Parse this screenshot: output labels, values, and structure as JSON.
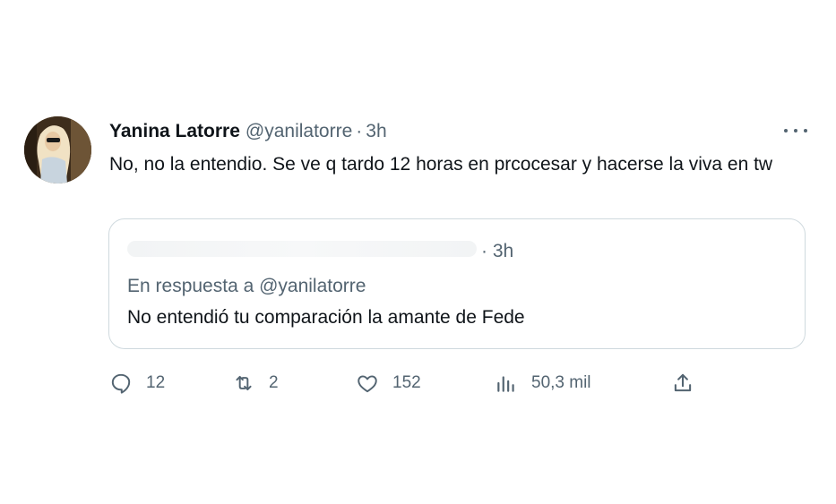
{
  "tweet": {
    "author_name": "Yanina Latorre",
    "handle": "@yanilatorre",
    "separator": "·",
    "time": "3h",
    "text": "No, no la entendio. Se ve q tardo 12 horas en prcocesar y hacerse la viva en tw",
    "more_icon": "more-horizontal-icon"
  },
  "quoted": {
    "separator_time": "· 3h",
    "reply_to": "En respuesta a @yanilatorre",
    "text": "No entendió tu comparación la amante de Fede"
  },
  "actions": {
    "replies": "12",
    "retweets": "2",
    "likes": "152",
    "views": "50,3 mil",
    "icons": [
      "reply-icon",
      "retweet-icon",
      "like-icon",
      "views-icon",
      "share-icon"
    ]
  },
  "colors": {
    "text": "#0f1419",
    "secondary": "#536471",
    "border": "#cfd9de",
    "background": "#ffffff"
  }
}
